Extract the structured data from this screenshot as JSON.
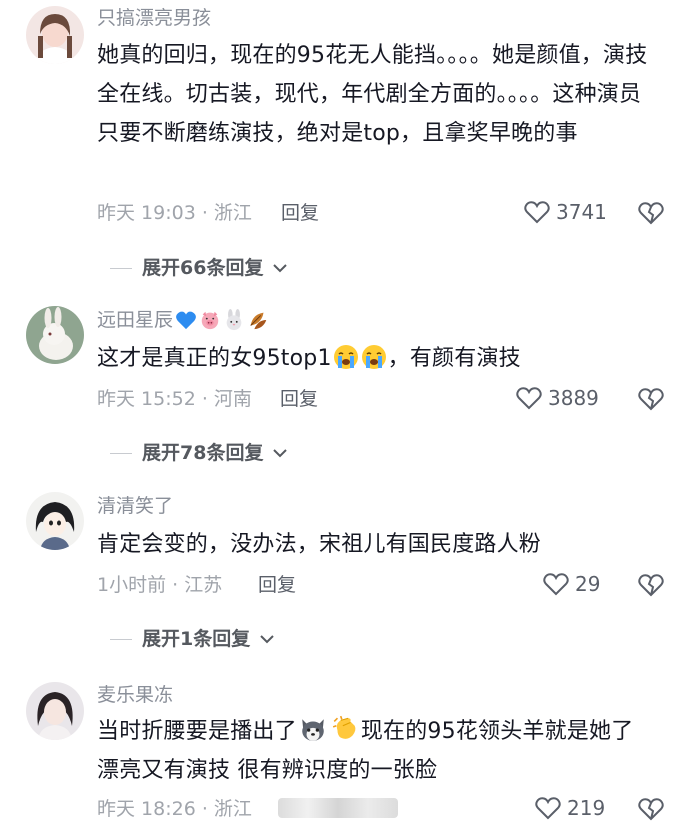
{
  "comments": [
    {
      "username": "只搞漂亮男孩",
      "text": "她真的回归，现在的95花无人能挡。。。。她是颜值，演技全在线。切古装，现代，年代剧全方面的。。。。这种演员只要不断磨练演技，绝对是top，且拿奖早晚的事",
      "meta": "昨天 19:03 · 浙江",
      "reply_label": "回复",
      "likes": "3741",
      "expand_label": "展开66条回复"
    },
    {
      "username": "远田星辰",
      "text_before": "这才是真正的女95top1",
      "text_after": "，有颜有演技",
      "meta": "昨天 15:52 · 河南",
      "reply_label": "回复",
      "likes": "3889",
      "expand_label": "展开78条回复"
    },
    {
      "username": "清清笑了",
      "text": "肯定会变的，没办法，宋祖儿有国民度路人粉",
      "meta": "1小时前 · 江苏",
      "reply_label": "回复",
      "likes": "29",
      "expand_label": "展开1条回复"
    },
    {
      "username": "麦乐果冻",
      "text_before": "当时折腰要是播出了",
      "text_after": "现在的95花领头羊就是她了 漂亮又有演技 很有辨识度的一张脸",
      "meta": "昨天 18:26 · 浙江",
      "likes": "219"
    }
  ],
  "icons": {
    "like": "heart-outline-icon",
    "dislike": "broken-heart-icon",
    "expand": "chevron-down-icon"
  }
}
